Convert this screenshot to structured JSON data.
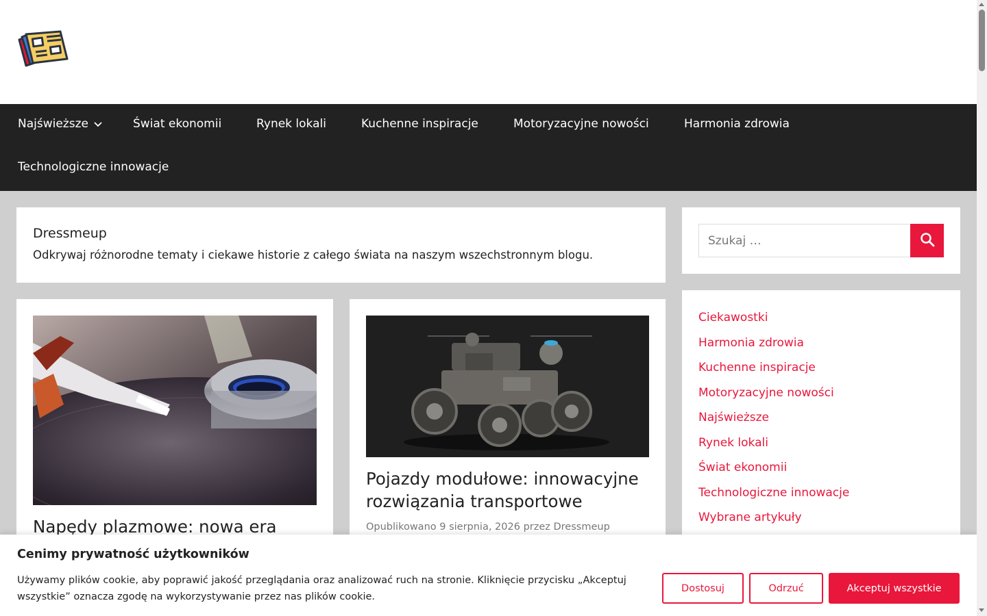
{
  "nav": {
    "items": [
      {
        "label": "Najświeższe",
        "has_dropdown": true
      },
      {
        "label": "Świat ekonomii"
      },
      {
        "label": "Rynek lokali"
      },
      {
        "label": "Kuchenne inspiracje"
      },
      {
        "label": "Motoryzacyjne nowości"
      },
      {
        "label": "Harmonia zdrowia"
      },
      {
        "label": "Technologiczne innowacje"
      }
    ]
  },
  "intro": {
    "title": "Dressmeup",
    "description": "Odkrywaj różnorodne tematy i ciekawe historie z całego świata na naszym wszechstronnym blogu."
  },
  "posts": [
    {
      "title": "Napędy plazmowe: nowa era",
      "image": "hard-drive-photo"
    },
    {
      "title": "Pojazdy modułowe: innowacyjne rozwiązania transportowe",
      "meta": "Opublikowano 9 sierpnia, 2026 przez Dressmeup",
      "image": "modular-vehicle-photo"
    }
  ],
  "search": {
    "placeholder": "Szukaj …"
  },
  "categories": [
    "Ciekawostki",
    "Harmonia zdrowia",
    "Kuchenne inspiracje",
    "Motoryzacyjne nowości",
    "Najświeższe",
    "Rynek lokali",
    "Świat ekonomii",
    "Technologiczne innowacje",
    "Wybrane artykuły"
  ],
  "cookie": {
    "title": "Cenimy prywatność użytkowników",
    "text": "Używamy plików cookie, aby poprawić jakość przeglądania oraz analizować ruch na stronie. Kliknięcie przycisku „Akceptuj wszystkie” oznacza zgodę na wykorzystywanie przez nas plików cookie.",
    "customize_label": "Dostosuj",
    "reject_label": "Odrzuć",
    "accept_label": "Akceptuj wszystkie"
  },
  "colors": {
    "accent": "#e8173b",
    "nav_bg": "#222222",
    "page_bg": "#cfcfcf"
  }
}
